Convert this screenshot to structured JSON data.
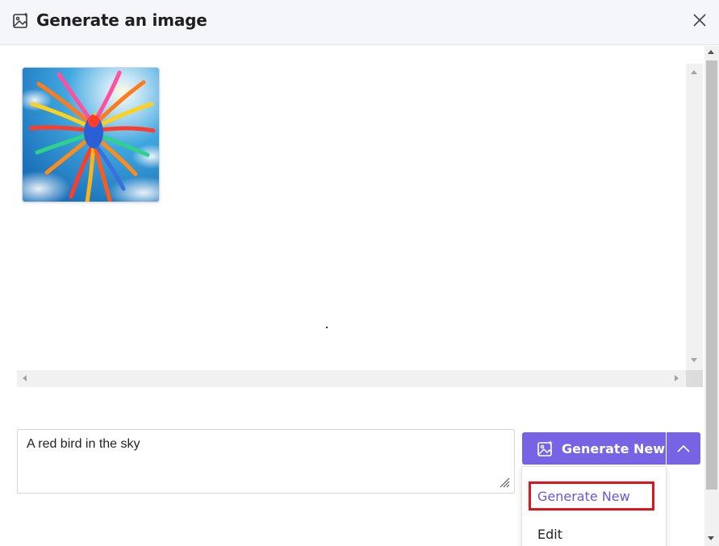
{
  "dialog": {
    "title": "Generate an image",
    "title_icon": "image-sparkle-icon",
    "close_icon": "close-icon"
  },
  "viewer": {
    "image_alt": "Colorful phoenix-like bird flying in a blue sky",
    "image_icon": "generated-image"
  },
  "prompt": {
    "value": "A red bird in the sky"
  },
  "actions": {
    "generate_label": "Generate New",
    "generate_icon": "image-sparkle-icon",
    "dropdown_icon": "chevron-up-icon"
  },
  "menu": {
    "items": [
      {
        "label": "Generate New"
      },
      {
        "label": "Edit"
      }
    ]
  },
  "colors": {
    "accent": "#7764e4",
    "highlight_border": "#e0141a",
    "header_bg": "#f5f6fa"
  }
}
